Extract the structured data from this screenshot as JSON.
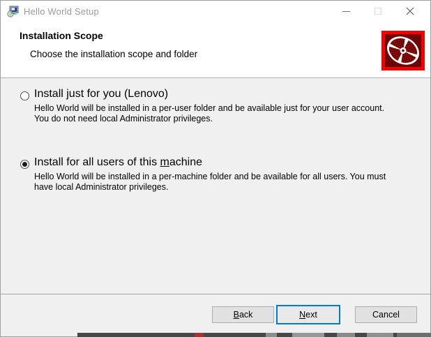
{
  "window": {
    "title": "Hello World Setup"
  },
  "header": {
    "title": "Installation Scope",
    "subtitle": "Choose the installation scope and folder"
  },
  "options": [
    {
      "selected": false,
      "label": {
        "pre": "Install just for you (Lenovo)",
        "accel": "",
        "post": ""
      },
      "description": "Hello World will be installed in a per-user folder and be available just for your user account. You do not need local Administrator privileges."
    },
    {
      "selected": true,
      "label": {
        "pre": "Install for all users of this ",
        "accel": "m",
        "post": "achine"
      },
      "description": "Hello World will be installed in a per-machine folder and be available for all users. You must have local Administrator privileges."
    }
  ],
  "footer": {
    "back": {
      "pre": "",
      "accel": "B",
      "post": "ack"
    },
    "next": {
      "pre": "",
      "accel": "N",
      "post": "ext"
    },
    "cancel": {
      "pre": "Cancel",
      "accel": "",
      "post": ""
    }
  },
  "icons": {
    "titlebar": "msi-installer-icon",
    "banner": "red-cd-disc-icon"
  },
  "colors": {
    "accent_focus": "#0078d7",
    "banner_frame": "#f40000",
    "banner_bg": "#6d0303",
    "titlebar_text": "#9a9a9a",
    "body_bg": "#f0f0f0"
  }
}
